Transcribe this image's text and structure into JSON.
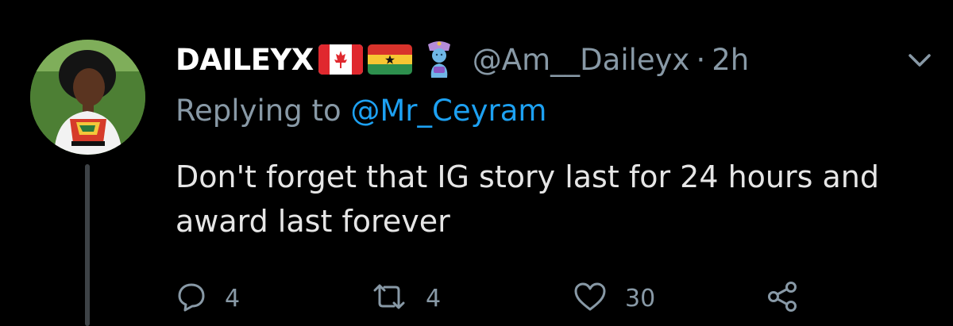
{
  "tweet": {
    "display_name": "DAILEYX",
    "handle": "@Am__Daileyx",
    "separator": "·",
    "time": "2h",
    "replying_prefix": "Replying to",
    "replying_to": "@Mr_Ceyram",
    "text": "Don't forget that IG story last for 24 hours and award last forever",
    "counts": {
      "replies": "4",
      "retweets": "4",
      "likes": "30"
    }
  },
  "icons": {
    "flag_1": "canada-flag-icon",
    "flag_2": "ghana-flag-icon",
    "emoji": "genie-icon",
    "menu": "chevron-down-icon",
    "reply": "reply-icon",
    "retweet": "retweet-icon",
    "like": "heart-icon",
    "share": "share-icon"
  },
  "colors": {
    "background": "#000000",
    "name": "#ffffff",
    "secondary": "#8899a6",
    "link": "#1da1f2",
    "body": "#e6e6e6"
  }
}
